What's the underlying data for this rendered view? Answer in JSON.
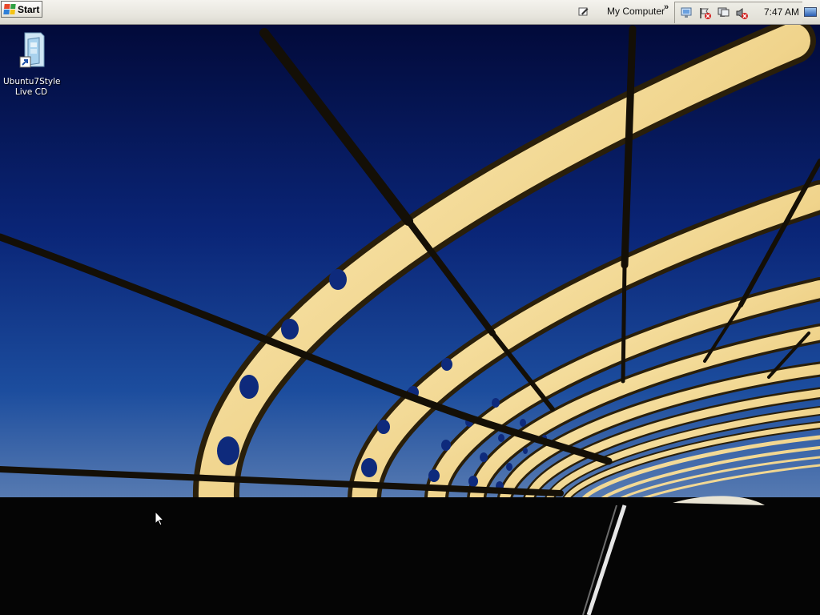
{
  "taskbar": {
    "start_label": "Start",
    "quicklaunch_label": "My Computer",
    "chevron": "»",
    "clock": "7:47 AM",
    "tray_icons": [
      "network-icon",
      "flag-alert-icon",
      "computer-alert-icon",
      "volume-muted-icon"
    ]
  },
  "desktop": {
    "icons": [
      {
        "line1": "Ubuntu7Style",
        "line2": "Live CD",
        "icon": "shortcut-icon"
      }
    ]
  },
  "colors": {
    "sky_top": "#020a3a",
    "sky_mid": "#0b2f8a",
    "sky_horizon": "#5d7fb3",
    "beam": "#f1d690",
    "beam_shadow": "#b08a3c",
    "ground": "#050505",
    "taskbar": "#e6e4dc"
  }
}
